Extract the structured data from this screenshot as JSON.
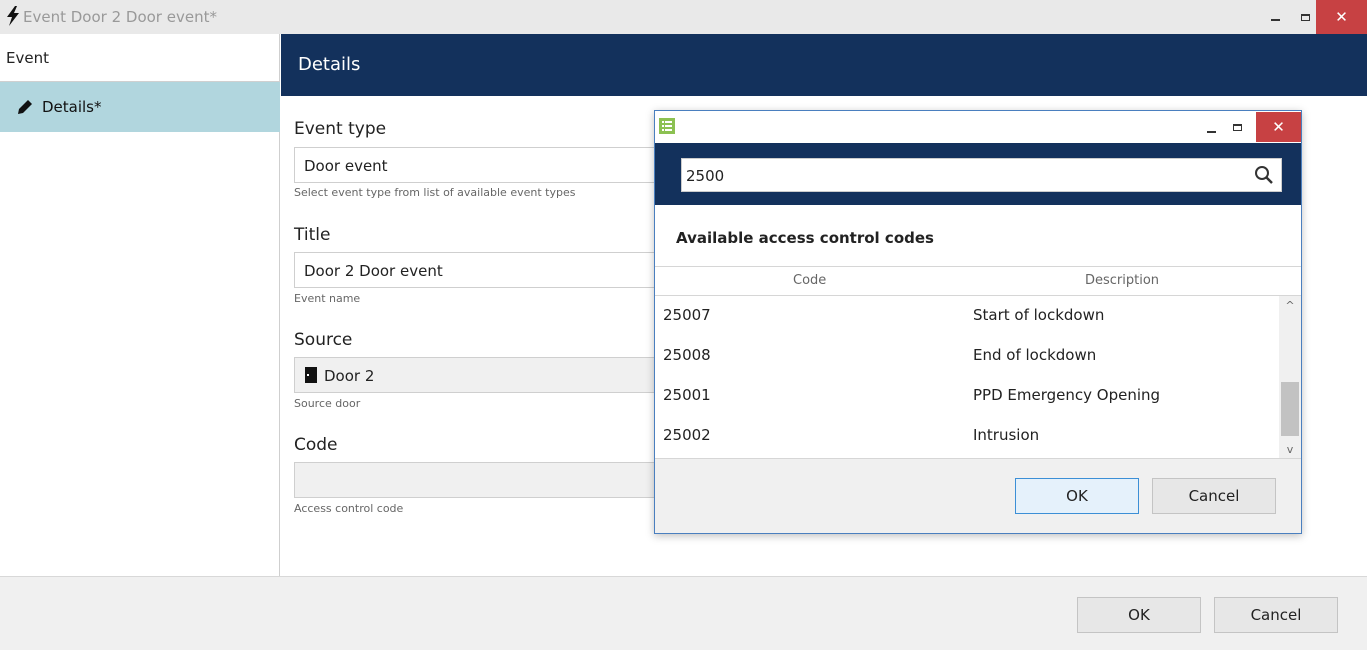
{
  "window": {
    "title": "Event Door 2 Door event*",
    "icon": "lightning-icon",
    "controls": {
      "minimize": "minimize",
      "maximize": "maximize",
      "close": "✕"
    }
  },
  "sidebar": {
    "header": "Event",
    "items": [
      {
        "label": "Details*",
        "icon": "pencil-icon",
        "selected": true
      }
    ]
  },
  "details": {
    "header": "Details",
    "fields": {
      "event_type": {
        "label": "Event type",
        "value": "Door event",
        "hint": "Select event type from list of available event types"
      },
      "title": {
        "label": "Title",
        "value": "Door 2 Door event",
        "hint": "Event name"
      },
      "source": {
        "label": "Source",
        "value": "Door 2",
        "icon": "door-icon",
        "hint": "Source door"
      },
      "code": {
        "label": "Code",
        "value": "",
        "hint": "Access control code"
      }
    }
  },
  "footer": {
    "ok": "OK",
    "cancel": "Cancel"
  },
  "dialog": {
    "icon": "list-icon",
    "search": {
      "value": "2500",
      "icon": "search-icon"
    },
    "section_title": "Available access control codes",
    "columns": {
      "code": "Code",
      "description": "Description"
    },
    "rows": [
      {
        "code": "25007",
        "description": "Start of lockdown"
      },
      {
        "code": "25008",
        "description": "End of lockdown"
      },
      {
        "code": "25001",
        "description": "PPD Emergency Opening"
      },
      {
        "code": "25002",
        "description": "Intrusion"
      }
    ],
    "scroll": {
      "up": "^",
      "down": "v"
    },
    "ok": "OK",
    "cancel": "Cancel",
    "controls": {
      "close": "✕"
    }
  },
  "colors": {
    "header_navy": "#13315c",
    "selected_item": "#b1d6de",
    "close_red": "#c74143",
    "dialog_border": "#4a7fbf"
  }
}
